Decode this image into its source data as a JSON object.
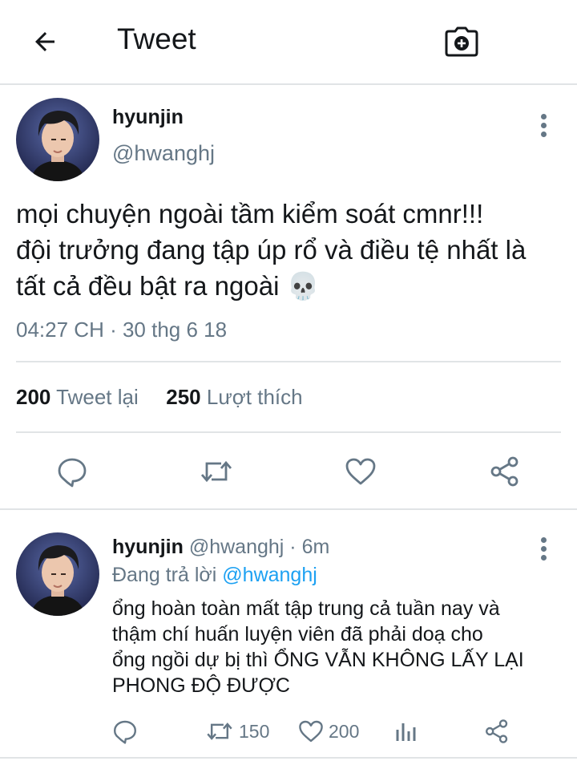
{
  "header": {
    "title": "Tweet",
    "back_icon": "arrow-left-icon",
    "camera_icon": "camera-plus-icon"
  },
  "tweet": {
    "name": "hyunjin",
    "handle": "@hwanghj",
    "text_lines": [
      "mọi chuyện ngoài tầm kiểm soát cmnr!!!",
      "đội trưởng đang tập úp rổ và điều tệ nhất là",
      "tất cả đều bật ra ngoài 💀"
    ],
    "timestamp": "04:27 CH · 30 thg 6 18",
    "retweet_count": "200",
    "retweet_label": "Tweet lại",
    "like_count": "250",
    "like_label": "Lượt thích"
  },
  "reply": {
    "name": "hyunjin",
    "handle_time": "@hwanghj · 6m",
    "replying_prefix": "Đang trả lời ",
    "replying_to": "@hwanghj",
    "text_lines": [
      "ổng hoàn toàn mất tập trung cả tuần nay và",
      "thậm chí huấn luyện viên đã phải doạ cho",
      "ổng ngồi dự bị thì ỔNG VẪN KHÔNG LẤY LẠI",
      "PHONG ĐỘ ĐƯỢC"
    ],
    "retweets": "150",
    "likes": "200"
  },
  "colors": {
    "text": "#14171a",
    "secondary": "#657786",
    "accent": "#1da1f2",
    "divider": "#e1e4e6"
  }
}
